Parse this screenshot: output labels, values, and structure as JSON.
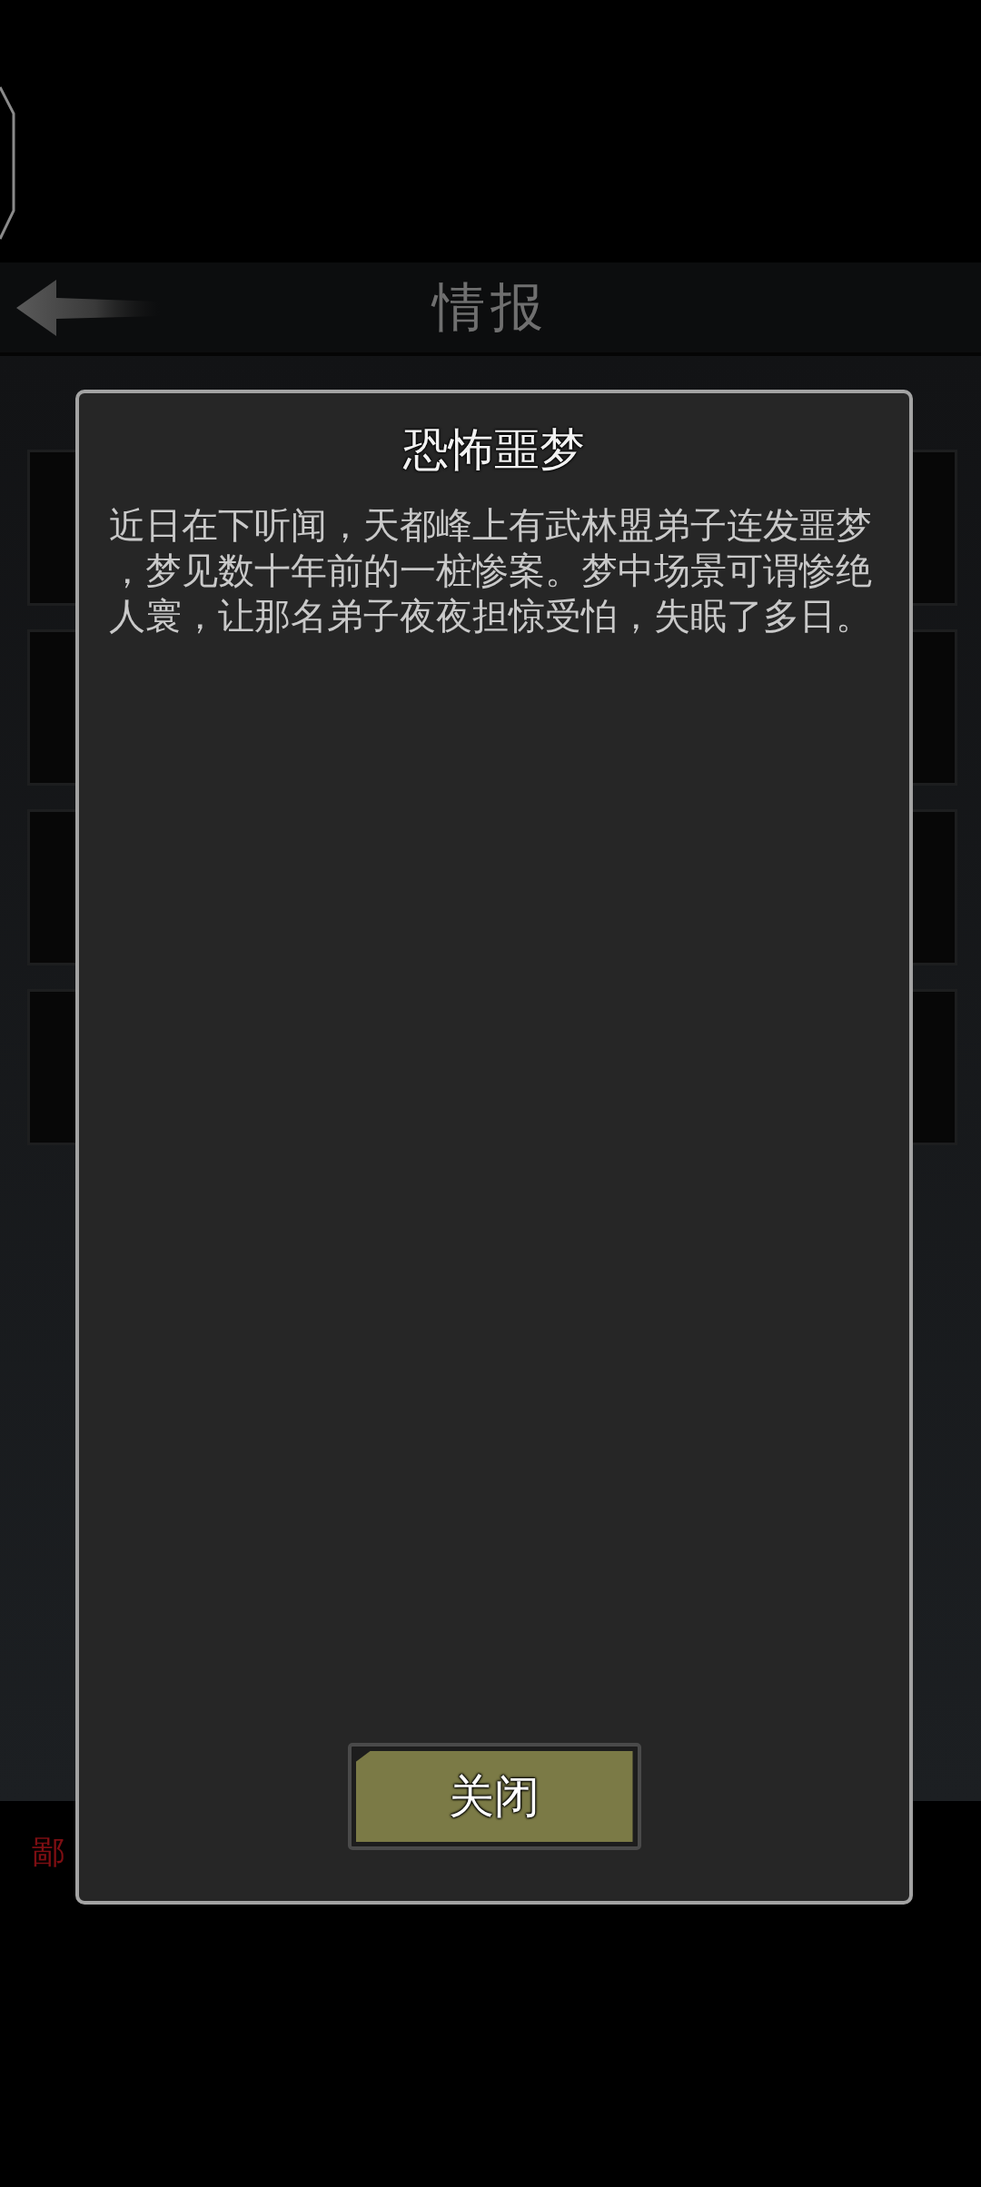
{
  "header": {
    "title": "情报"
  },
  "footer": {
    "text": "鄙"
  },
  "dialog": {
    "title": "恐怖噩梦",
    "body": "近日在下听闻，天都峰上有武林盟弟子连发噩梦，梦见数十年前的一桩惨案。梦中场景可谓惨绝人寰，让那名弟子夜夜担惊受怕，失眠了多日。",
    "buttons": [
      {
        "label": "关闭"
      }
    ]
  }
}
